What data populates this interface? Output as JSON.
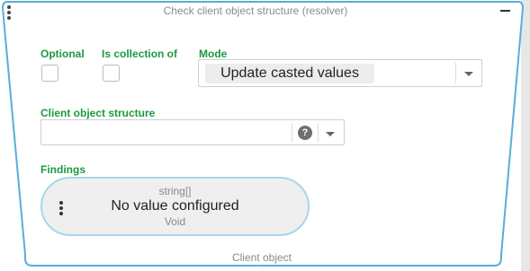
{
  "node": {
    "title": "Check client object structure (resolver)",
    "output_label": "Client object"
  },
  "fields": {
    "optional_label": "Optional",
    "is_collection_label": "Is collection of",
    "mode_label": "Mode",
    "mode_value": "Update casted values",
    "client_object_structure_label": "Client object structure",
    "client_object_structure_value": "",
    "help_glyph": "?"
  },
  "findings": {
    "label": "Findings",
    "type": "string[]",
    "value": "No value configured",
    "subtext": "Void"
  },
  "colors": {
    "label_green": "#1a9a3f",
    "pill_border": "#a7d5ec",
    "block_border": "#5aaed6"
  },
  "icons": {
    "node_menu": "vertical-ellipsis-icon",
    "collapse": "minus-icon",
    "dropdown": "chevron-down-icon",
    "help": "question-circle-icon"
  }
}
